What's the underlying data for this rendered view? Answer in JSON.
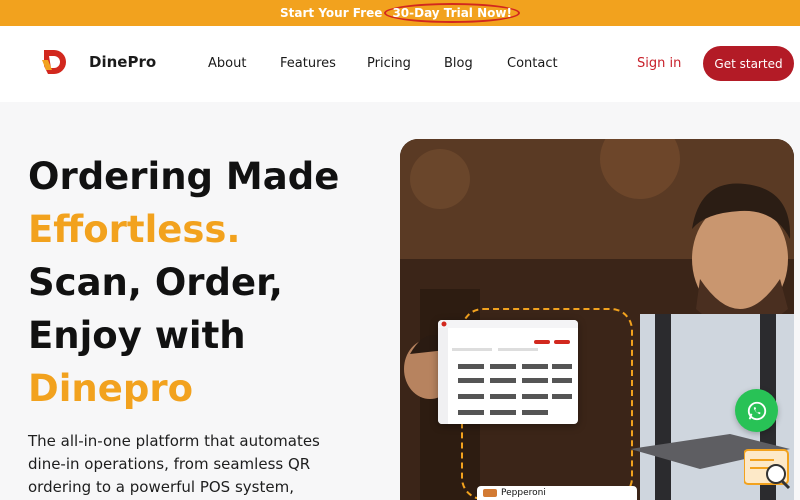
{
  "promo": {
    "text": "Start Your Free",
    "highlight": "30-Day Trial Now!"
  },
  "brand": {
    "name": "DinePro",
    "logo_icon": "dinepro-logo-icon",
    "color_red": "#c8202a",
    "color_orange": "#f2a21e"
  },
  "nav": {
    "links": [
      "About",
      "Features",
      "Pricing",
      "Blog",
      "Contact"
    ],
    "signin": "Sign in",
    "cta": "Get started"
  },
  "hero": {
    "line1": "Ordering Made",
    "line2": "Effortless.",
    "line3": "Scan, Order,",
    "line4": "Enjoy with",
    "line5": "Dinepro",
    "description": "The all-in-one platform that automates dine-in operations, from seamless QR ordering to a powerful POS system,"
  },
  "image": {
    "menu_item": "Pepperoni"
  },
  "fab": {
    "whatsapp_icon": "whatsapp-icon",
    "chat_icon": "chat-search-icon"
  }
}
